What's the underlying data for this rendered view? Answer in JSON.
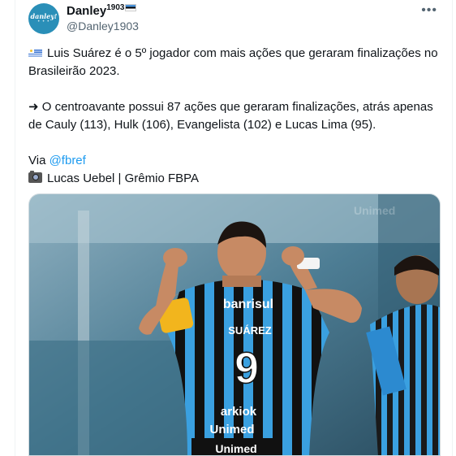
{
  "author": {
    "display_name": "Danley",
    "superscript": "1903",
    "handle": "@Danley1903",
    "avatar_text": "danley!",
    "avatar_dots": "• • •"
  },
  "menu": {
    "more_label": "•••"
  },
  "tweet": {
    "line1": "Luis Suárez é o 5º jogador com mais ações que geraram finalizações no Brasileirão 2023.",
    "line2": "➜ O centroavante possui 87 ações que geraram finalizações, atrás apenas de Cauly (113), Hulk (106), Evangelista (102) e Lucas Lima (95).",
    "via_prefix": "Via ",
    "via_link": "@fbref",
    "credit": "Lucas Uebel | Grêmio FBPA"
  },
  "media": {
    "shirt_sponsor": "banrisul",
    "player_name": "SUÁREZ",
    "shirt_number": "9",
    "sponsor_2": "arkiok",
    "sponsor_3": "Unimed",
    "sponsor_4": "Unimed",
    "bg_sponsor": "Unimed"
  },
  "colors": {
    "link": "#1d9bf0",
    "gremio_blue": "#3aa0e0",
    "gremio_black": "#111111"
  }
}
